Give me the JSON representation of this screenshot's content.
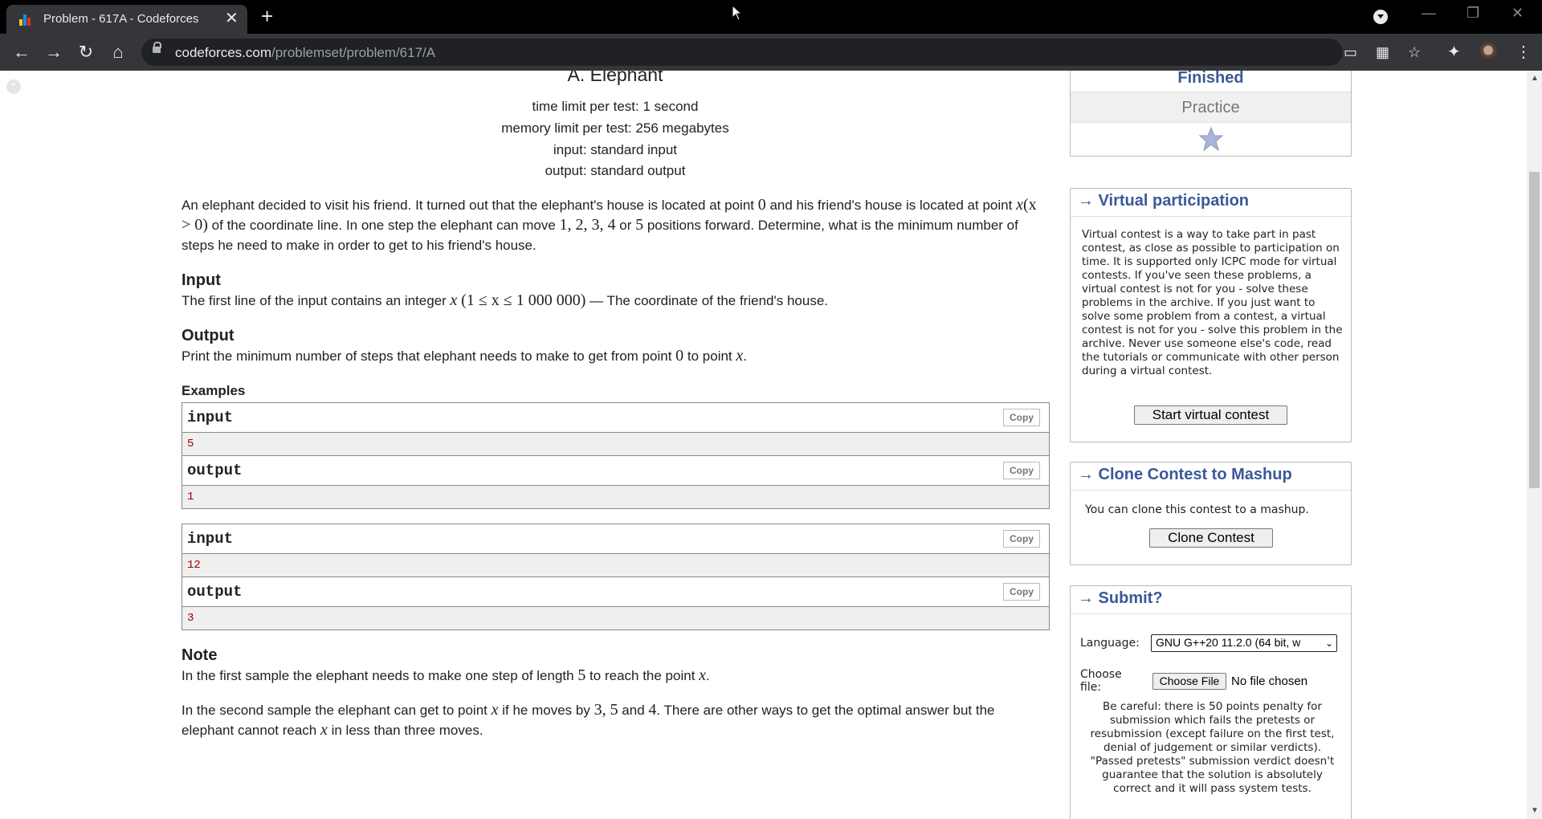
{
  "browser": {
    "tab_title": "Problem - 617A - Codeforces",
    "url_host": "codeforces.com",
    "url_path": "/problemset/problem/617/A",
    "icons": [
      "back-icon",
      "forward-icon",
      "reload-icon",
      "home-icon",
      "lock-icon",
      "cast-icon",
      "qr-icon",
      "bookmark-star-icon",
      "extensions-icon",
      "profile-avatar",
      "menu-icon"
    ]
  },
  "problem": {
    "title": "A. Elephant",
    "time_limit": "time limit per test: 1 second",
    "memory_limit": "memory limit per test: 256 megabytes",
    "input_file": "input: standard input",
    "output_file": "output: standard output",
    "statement": {
      "s1": "An elephant decided to visit his friend. It turned out that the elephant's house is located at point ",
      "m1": "0",
      "s2": " and his friend's house is located at point ",
      "m2": "x",
      "m3": "(x > 0)",
      "s3": " of the coordinate line. In one step the elephant can move ",
      "m4": "1, 2, 3, 4",
      "s4": " or ",
      "m5": "5",
      "s5": " positions forward. Determine, what is the minimum number of steps he need to make in order to get to his friend's house."
    },
    "input_title": "Input",
    "input_spec": {
      "s1": "The first line of the input contains an integer ",
      "m1": "x",
      "m2": "(1 ≤ x ≤ 1 000 000)",
      "s2": " — The coordinate of the friend's house."
    },
    "output_title": "Output",
    "output_spec": {
      "s1": "Print the minimum number of steps that elephant needs to make to get from point ",
      "m1": "0",
      "s2": " to point ",
      "m2": "x",
      "s3": "."
    },
    "examples_title": "Examples",
    "copy_label": "Copy",
    "examples": [
      {
        "input_label": "input",
        "input": "5",
        "output_label": "output",
        "output": "1"
      },
      {
        "input_label": "input",
        "input": "12",
        "output_label": "output",
        "output": "3"
      }
    ],
    "note_title": "Note",
    "note1": {
      "s1": "In the first sample the elephant needs to make one step of length ",
      "m1": "5",
      "s2": " to reach the point ",
      "m2": "x",
      "s3": "."
    },
    "note2": {
      "s1": "In the second sample the elephant can get to point ",
      "m1": "x",
      "s2": " if he moves by ",
      "m2": "3, 5",
      "s3": " and ",
      "m3": "4",
      "s4": ". There are other ways to get the optimal answer but the elephant cannot reach ",
      "m4": "x",
      "s5": " in less than three moves."
    }
  },
  "sidebar": {
    "contest_status": "Finished",
    "contest_mode": "Practice",
    "virtual": {
      "title": "→ Virtual participation",
      "text": "Virtual contest is a way to take part in past contest, as close as possible to participation on time. It is supported only ICPC mode for virtual contests. If you've seen these problems, a virtual contest is not for you - solve these problems in the archive. If you just want to solve some problem from a contest, a virtual contest is not for you - solve this problem in the archive. Never use someone else's code, read the tutorials or communicate with other person during a virtual contest.",
      "button": "Start virtual contest"
    },
    "clone": {
      "title": "→ Clone Contest to Mashup",
      "text": "You can clone this contest to a mashup.",
      "button": "Clone Contest"
    },
    "submit": {
      "title": "→ Submit?",
      "language_label": "Language:",
      "language_value": "GNU G++20 11.2.0 (64 bit, w",
      "file_label": "Choose file:",
      "file_button": "Choose File",
      "file_status": "No file chosen",
      "warning": "Be careful: there is 50 points penalty for submission which fails the pretests or resubmission (except failure on the first test, denial of judgement or similar verdicts). \"Passed pretests\" submission verdict doesn't guarantee that the solution is absolutely correct and it will pass system tests."
    }
  }
}
